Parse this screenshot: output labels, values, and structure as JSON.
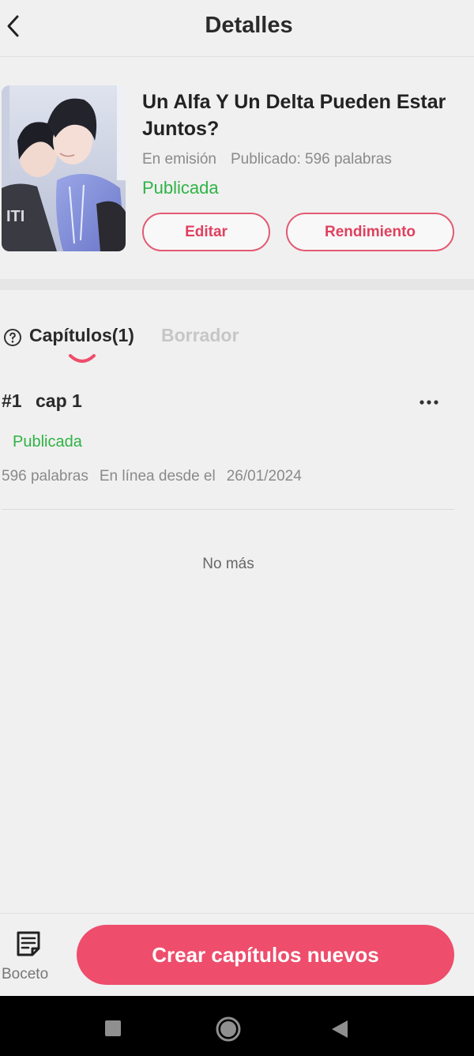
{
  "header": {
    "title": "Detalles",
    "back_icon": "chevron-left-icon"
  },
  "book": {
    "cover_icon": "book-cover-illustration",
    "title": "Un Alfa Y Un Delta Pueden Estar Juntos?",
    "serial_status": "En emisión",
    "published_words": "Publicado: 596 palabras",
    "publish_state": "Publicada",
    "edit_label": "Editar",
    "performance_label": "Rendimiento"
  },
  "tabs": {
    "help_icon": "question-circle-icon",
    "chapters_label": "Capítulos(1)",
    "drafts_label": "Borrador",
    "active": "chapters"
  },
  "chapters": [
    {
      "number": "#1",
      "title": "cap 1",
      "status": "Publicada",
      "words": "596 palabras",
      "online_label": "En línea desde el",
      "date": "26/01/2024"
    }
  ],
  "list_end": "No más",
  "bottom": {
    "draft_label": "Boceto",
    "draft_icon": "note-icon",
    "create_label": "Crear capítulos nuevos"
  },
  "colors": {
    "accent": "#ee4d6c",
    "accent_text": "#e0405e",
    "published_green": "#2fb344",
    "background": "#f0f0f0"
  }
}
